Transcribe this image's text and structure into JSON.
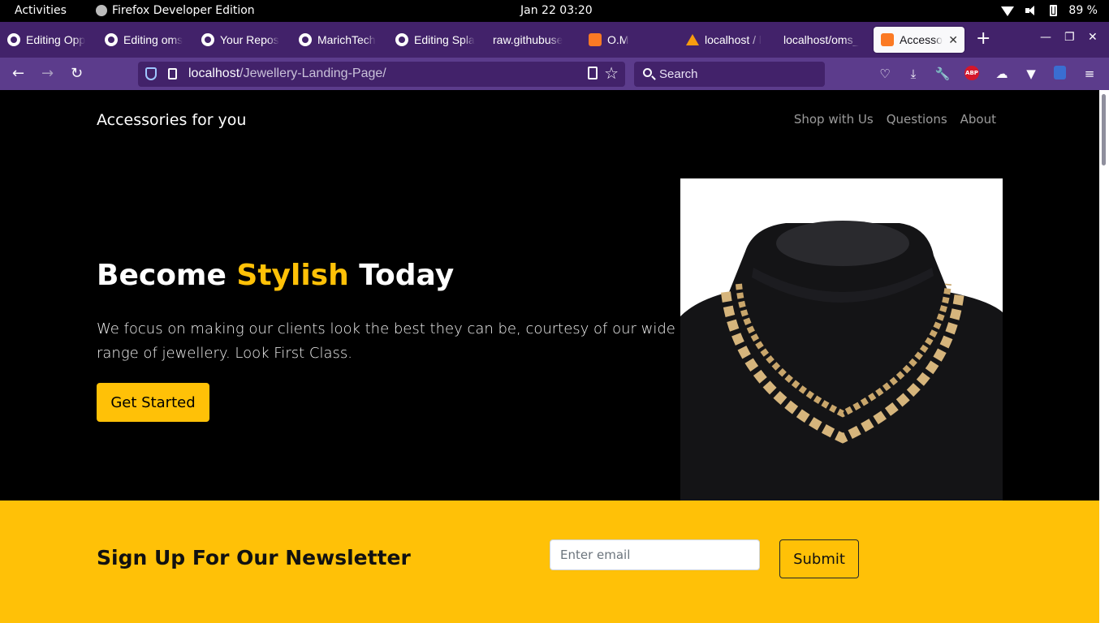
{
  "os_bar": {
    "activities": "Activities",
    "app_name": "Firefox Developer Edition",
    "clock": "Jan 22  03:20",
    "battery": "89 %"
  },
  "browser": {
    "tabs": [
      {
        "label": "Editing Opp",
        "icon": "github-icon"
      },
      {
        "label": "Editing oms",
        "icon": "github-icon"
      },
      {
        "label": "Your Repos",
        "icon": "github-icon"
      },
      {
        "label": "MarichTech",
        "icon": "github-icon"
      },
      {
        "label": "Editing Spla",
        "icon": "github-icon"
      },
      {
        "label": "raw.githubuse",
        "icon": "none"
      },
      {
        "label": "O.M",
        "icon": "xampp-icon"
      },
      {
        "label": "localhost / l",
        "icon": "phpmyadmin-icon"
      },
      {
        "label": "localhost/oms_",
        "icon": "none"
      },
      {
        "label": "Accessori",
        "icon": "xampp-icon",
        "active": true
      }
    ],
    "url_host": "localhost",
    "url_path": "/Jewellery-Landing-Page/",
    "search_placeholder": "Search"
  },
  "site": {
    "brand": "Accessories for you",
    "nav": [
      "Shop with Us",
      "Questions",
      "About"
    ],
    "hero": {
      "title_part1": "Become ",
      "title_accent": "Stylish",
      "title_part2": " Today",
      "text": "We focus on making our clients look the best they can be, courtesy of our wide range of jewellery. Look First Class.",
      "cta": "Get Started"
    },
    "newsletter": {
      "title": "Sign Up For Our Newsletter",
      "email_placeholder": "Enter email",
      "submit": "Submit"
    },
    "colors": {
      "accent": "#ffc107",
      "background": "#000000",
      "browser_chrome": "#42226a"
    }
  }
}
